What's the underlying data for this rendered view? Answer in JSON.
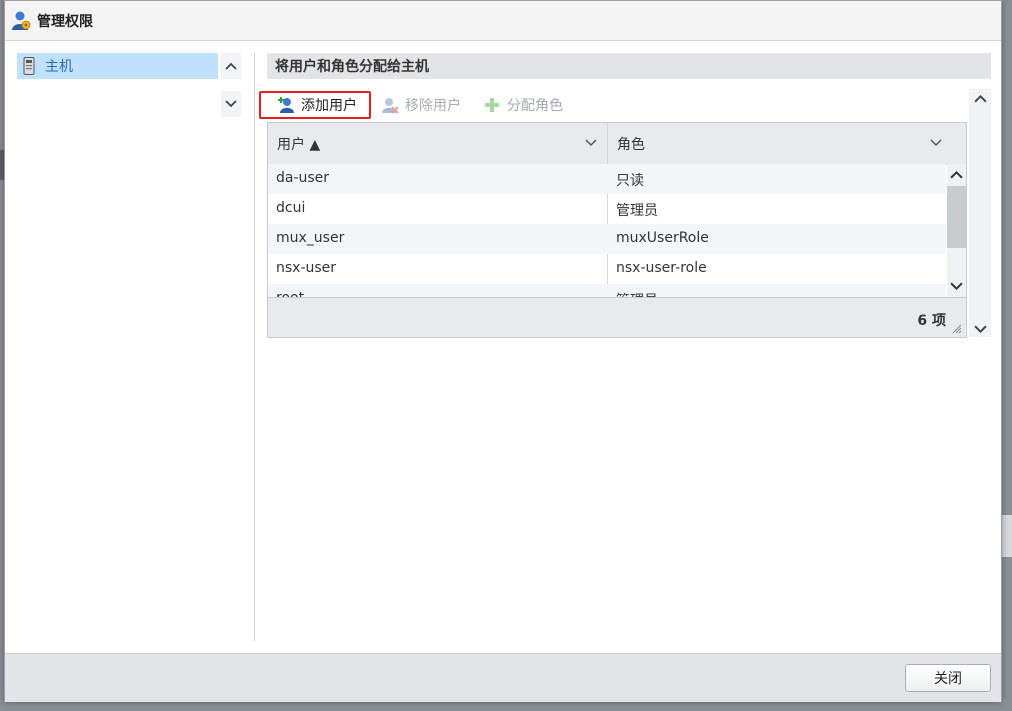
{
  "window": {
    "title": "管理权限"
  },
  "left": {
    "tree_item": "主机"
  },
  "right": {
    "section_title": "将用户和角色分配给主机",
    "toolbar": {
      "add_user": "添加用户",
      "remove_user": "移除用户",
      "assign_role": "分配角色"
    },
    "grid": {
      "col_user": "用户 ▲",
      "col_role": "角色",
      "rows": [
        {
          "user": "da-user",
          "role": "只读"
        },
        {
          "user": "dcui",
          "role": "管理员"
        },
        {
          "user": "mux_user",
          "role": "muxUserRole"
        },
        {
          "user": "nsx-user",
          "role": "nsx-user-role"
        },
        {
          "user": "root",
          "role": "管理员"
        }
      ],
      "count": "6 项"
    }
  },
  "footer": {
    "close": "关闭"
  },
  "colors": {
    "highlight_border": "#e0211c",
    "selected_bg": "#bfe1fb",
    "link_blue": "#2a6bb4"
  }
}
